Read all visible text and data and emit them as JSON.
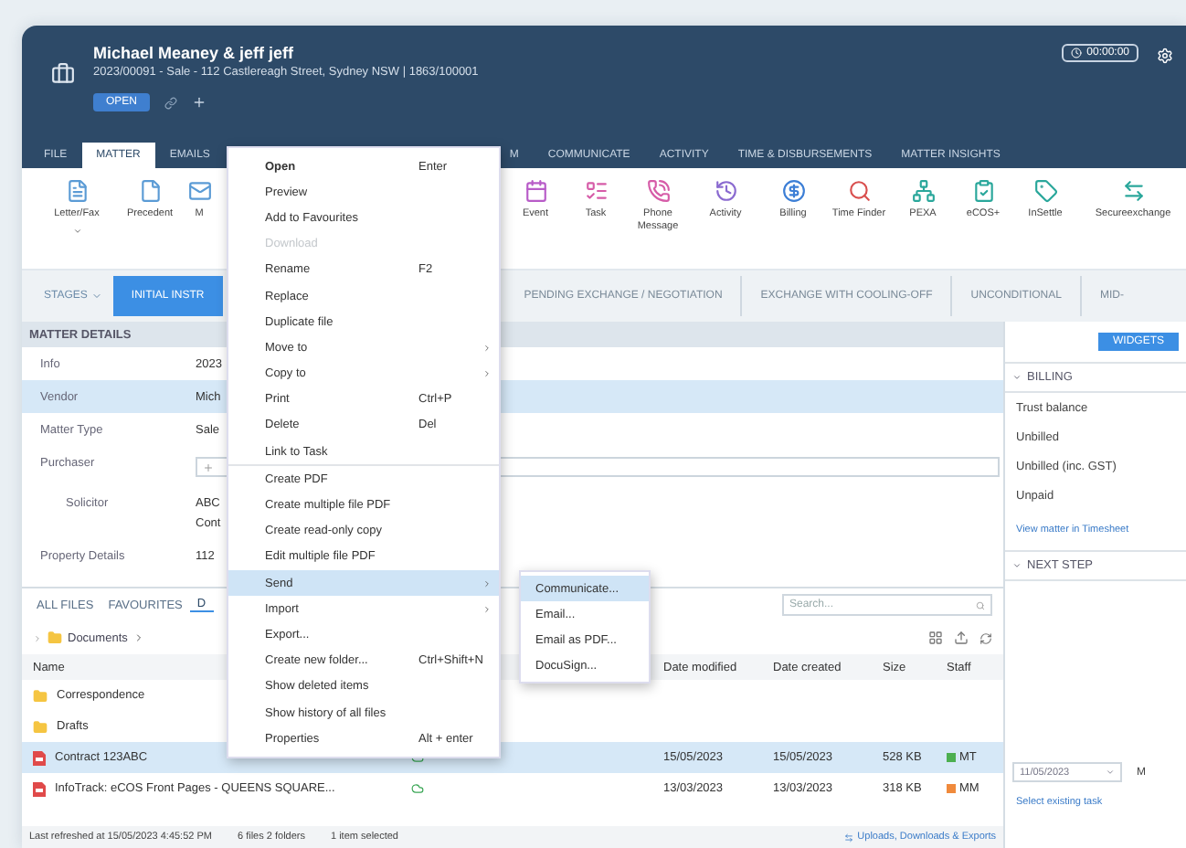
{
  "header": {
    "title": "Michael Meaney & jeff jeff",
    "subtitle": "2023/00091 - Sale - 112 Castlereagh Street, Sydney NSW | 1863/100001",
    "status": "OPEN",
    "timer": "00:00:00"
  },
  "tabs": [
    {
      "label": "FILE",
      "selected": false
    },
    {
      "label": "MATTER",
      "selected": true
    },
    {
      "label": "EMAILS",
      "selected": false
    },
    {
      "label": "M",
      "selected": false
    },
    {
      "label": "COMMUNICATE",
      "selected": false
    },
    {
      "label": "ACTIVITY",
      "selected": false
    },
    {
      "label": "TIME & DISBURSEMENTS",
      "selected": false
    },
    {
      "label": "MATTER INSIGHTS",
      "selected": false
    }
  ],
  "ribbon": [
    {
      "label": "Letter/Fax",
      "has_menu": true
    },
    {
      "label": "Precedent",
      "has_menu": false
    },
    {
      "label": "M",
      "has_menu": false
    },
    {
      "label": "Event",
      "has_menu": false
    },
    {
      "label": "Task",
      "has_menu": false
    },
    {
      "label": "Phone Message",
      "has_menu": false
    },
    {
      "label": "Activity",
      "has_menu": false
    },
    {
      "label": "Billing",
      "has_menu": false
    },
    {
      "label": "Time Finder",
      "has_menu": false
    },
    {
      "label": "PEXA",
      "has_menu": false
    },
    {
      "label": "eCOS+",
      "has_menu": false
    },
    {
      "label": "InSettle",
      "has_menu": false
    },
    {
      "label": "Secureexchange",
      "has_menu": false
    }
  ],
  "stages_button": "STAGES",
  "stages": [
    {
      "label": "INITIAL INSTR",
      "selected": true
    },
    {
      "label": "PENDING EXCHANGE / NEGOTIATION",
      "selected": false
    },
    {
      "label": "EXCHANGE WITH COOLING-OFF",
      "selected": false
    },
    {
      "label": "UNCONDITIONAL",
      "selected": false
    },
    {
      "label": "MID-",
      "selected": false
    }
  ],
  "matter_details": {
    "title": "MATTER DETAILS",
    "rows": [
      {
        "kind": "text",
        "label": "Info",
        "value": "2023",
        "selected": false
      },
      {
        "kind": "text",
        "label": "Vendor",
        "value": "Mich",
        "selected": true
      },
      {
        "kind": "text",
        "label": "Matter Type",
        "value": "Sale",
        "selected": false
      },
      {
        "kind": "input",
        "label": "Purchaser",
        "selected": false
      },
      {
        "kind": "sub",
        "label": "Solicitor",
        "value": "ABC",
        "extra": "Cont",
        "selected": false
      },
      {
        "kind": "text",
        "label": "Property Details",
        "value": "112",
        "selected": false
      }
    ]
  },
  "side": {
    "widgets_button": "WIDGETS",
    "billing": {
      "title": "BILLING",
      "rows": [
        "Trust balance",
        "Unbilled",
        "Unbilled (inc. GST)",
        "Unpaid"
      ],
      "link": "View matter in Timesheet"
    },
    "next_step": {
      "title": "NEXT STEP",
      "date": "11/05/2023",
      "cut": "M",
      "link": "Select existing task"
    }
  },
  "files": {
    "tabs": [
      {
        "label": "ALL FILES",
        "selected": false
      },
      {
        "label": "FAVOURITES",
        "selected": false
      },
      {
        "label": "D",
        "selected": true
      }
    ],
    "search": {
      "placeholder": "Search..."
    },
    "breadcrumb": "Documents",
    "columns": [
      "Name",
      "Date modified",
      "Date created",
      "Size",
      "Staff"
    ],
    "rows": [
      {
        "kind": "folder",
        "name": "Correspondence",
        "color": "#f5c542",
        "selected": false
      },
      {
        "kind": "folder",
        "name": "Drafts",
        "color": "#f5c542",
        "selected": false
      },
      {
        "kind": "pdf",
        "name": "Contract 123ABC",
        "modified": "15/05/2023",
        "created": "15/05/2023",
        "size": "528 KB",
        "staff": "MT",
        "color": "#4caf50",
        "selected": true
      },
      {
        "kind": "pdf",
        "name": "InfoTrack: eCOS Front Pages - QUEENS SQUARE...",
        "modified": "13/03/2023",
        "created": "13/03/2023",
        "size": "318 KB",
        "staff": "MM",
        "color": "#f08a3c",
        "selected": false
      }
    ],
    "status": {
      "refreshed": "Last refreshed at 15/05/2023 4:45:52 PM",
      "counts": "6 files 2 folders",
      "selection": "1 item selected",
      "transfers": "Uploads, Downloads & Exports"
    }
  },
  "context_menu": {
    "items": [
      {
        "kind": "item",
        "label": "Open",
        "shortcut": "Enter",
        "submenu": false,
        "default": true,
        "disabled": false,
        "selected": false
      },
      {
        "kind": "item",
        "label": "Preview",
        "submenu": false,
        "default": false,
        "disabled": false,
        "selected": false
      },
      {
        "kind": "item",
        "label": "Add to Favourites",
        "submenu": false,
        "default": false,
        "disabled": false,
        "selected": false
      },
      {
        "kind": "item",
        "label": "Download",
        "submenu": false,
        "default": false,
        "disabled": true,
        "selected": false
      },
      {
        "kind": "item",
        "label": "Rename",
        "shortcut": "F2",
        "submenu": false,
        "default": false,
        "disabled": false,
        "selected": false
      },
      {
        "kind": "item",
        "label": "Replace",
        "submenu": false,
        "default": false,
        "disabled": false,
        "selected": false
      },
      {
        "kind": "item",
        "label": "Duplicate file",
        "submenu": false,
        "default": false,
        "disabled": false,
        "selected": false
      },
      {
        "kind": "item",
        "label": "Move to",
        "submenu": true,
        "default": false,
        "disabled": false,
        "selected": false
      },
      {
        "kind": "item",
        "label": "Copy to",
        "submenu": true,
        "default": false,
        "disabled": false,
        "selected": false
      },
      {
        "kind": "item",
        "label": "Print",
        "shortcut": "Ctrl+P",
        "submenu": false,
        "default": false,
        "disabled": false,
        "selected": false
      },
      {
        "kind": "item",
        "label": "Delete",
        "shortcut": "Del",
        "submenu": false,
        "default": false,
        "disabled": false,
        "selected": false
      },
      {
        "kind": "item",
        "label": "Link to Task",
        "submenu": false,
        "default": false,
        "disabled": false,
        "selected": false
      },
      {
        "kind": "separator"
      },
      {
        "kind": "item",
        "label": "Create PDF",
        "submenu": false,
        "default": false,
        "disabled": false,
        "selected": false
      },
      {
        "kind": "item",
        "label": "Create multiple file PDF",
        "submenu": false,
        "default": false,
        "disabled": false,
        "selected": false
      },
      {
        "kind": "item",
        "label": "Create read-only copy",
        "submenu": false,
        "default": false,
        "disabled": false,
        "selected": false
      },
      {
        "kind": "item",
        "label": "Edit multiple file PDF",
        "submenu": false,
        "default": false,
        "disabled": false,
        "selected": false
      },
      {
        "kind": "item",
        "label": "Send",
        "submenu": true,
        "default": false,
        "disabled": false,
        "selected": true
      },
      {
        "kind": "item",
        "label": "Import",
        "submenu": true,
        "default": false,
        "disabled": false,
        "selected": false
      },
      {
        "kind": "item",
        "label": "Export...",
        "submenu": false,
        "default": false,
        "disabled": false,
        "selected": false
      },
      {
        "kind": "item",
        "label": "Create new folder...",
        "shortcut": "Ctrl+Shift+N",
        "submenu": false,
        "default": false,
        "disabled": false,
        "selected": false
      },
      {
        "kind": "item",
        "label": "Show deleted items",
        "submenu": false,
        "default": false,
        "disabled": false,
        "selected": false
      },
      {
        "kind": "item",
        "label": "Show history of all files",
        "submenu": false,
        "default": false,
        "disabled": false,
        "selected": false
      },
      {
        "kind": "item",
        "label": "Properties",
        "shortcut": "Alt + enter",
        "submenu": false,
        "default": false,
        "disabled": false,
        "selected": false
      }
    ],
    "submenu": [
      {
        "label": "Communicate...",
        "selected": true
      },
      {
        "label": "Email...",
        "selected": false
      },
      {
        "label": "Email as PDF...",
        "selected": false
      },
      {
        "label": "DocuSign...",
        "selected": false
      }
    ]
  }
}
